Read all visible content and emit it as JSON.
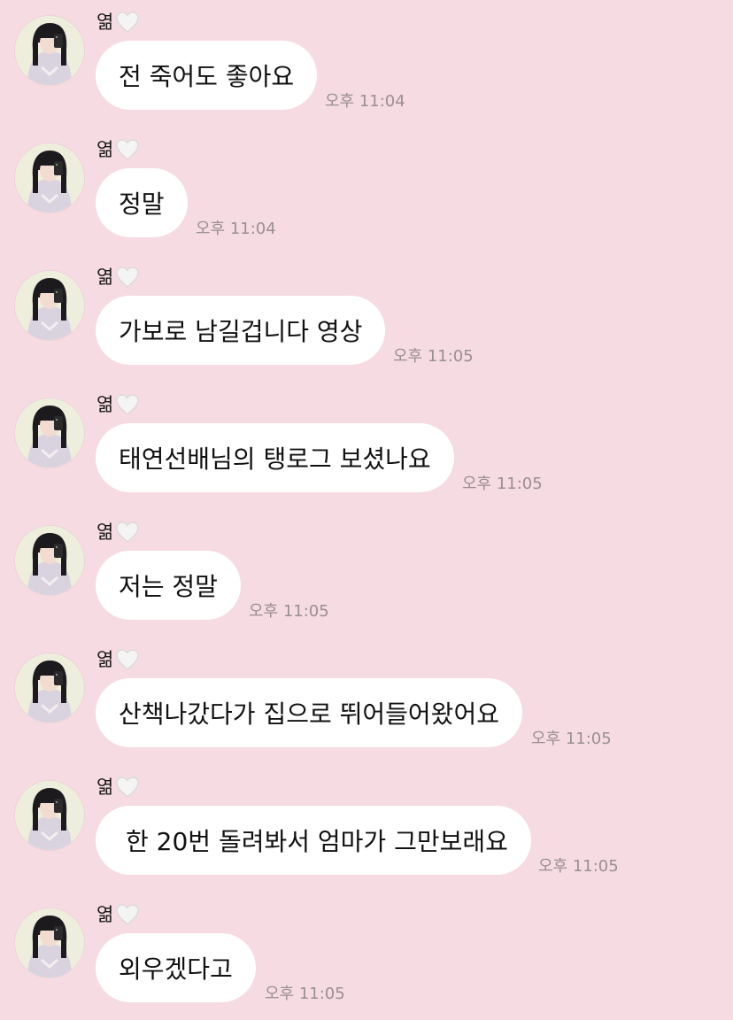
{
  "sender": {
    "name": "엶",
    "badge_icon": "white-heart-icon"
  },
  "messages": [
    {
      "text": "전 죽어도 좋아요",
      "time": "오후 11:04"
    },
    {
      "text": "정말",
      "time": "오후 11:04"
    },
    {
      "text": "가보로 남길겁니다 영상",
      "time": "오후 11:05"
    },
    {
      "text": "태연선배님의 탱로그 보셨나요",
      "time": "오후 11:05"
    },
    {
      "text": "저는 정말",
      "time": "오후 11:05"
    },
    {
      "text": "산책나갔다가 집으로 뛰어들어왔어요",
      "time": "오후 11:05"
    },
    {
      "text": "한 20번 돌려봐서 엄마가 그만보래요",
      "time": "오후 11:05"
    },
    {
      "text": "외우겠다고",
      "time": "오후 11:05"
    }
  ],
  "colors": {
    "background": "#f6dbe2",
    "bubble": "#ffffff",
    "timestamp": "#9a8f92"
  }
}
